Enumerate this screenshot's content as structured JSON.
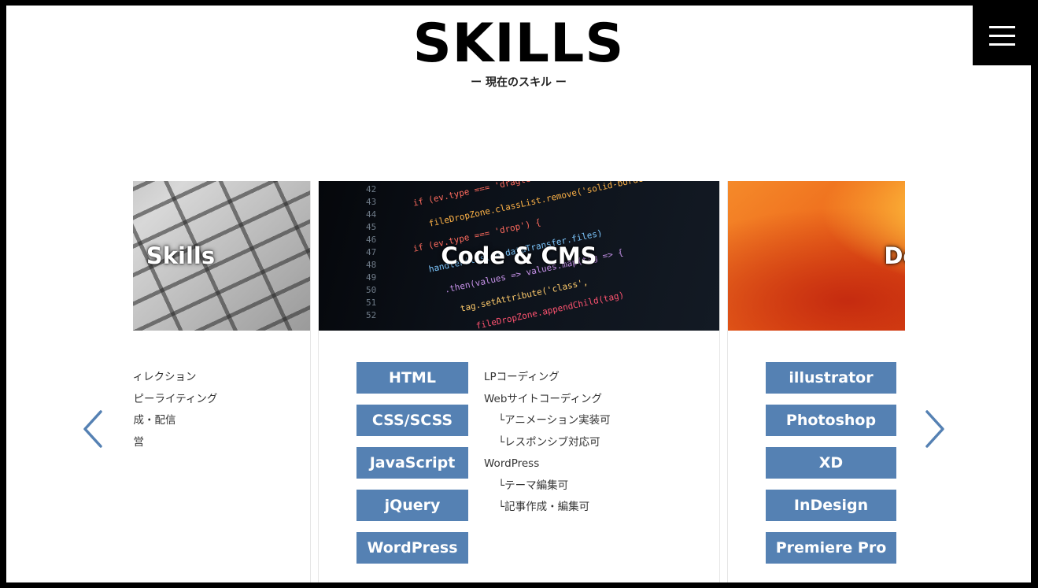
{
  "header": {
    "title": "SKILLS",
    "subtitle": "ー 現在のスキル ー"
  },
  "menu": {
    "icon": "hamburger-menu-icon"
  },
  "nav": {
    "prev_icon": "chevron-left-icon",
    "next_icon": "chevron-right-icon",
    "accent": "#5581b3"
  },
  "cards": [
    {
      "title": "Skills",
      "image": "keyboard-photo",
      "lines": [
        "ディレクション",
        "コピーライティング",
        "作成・配信",
        "運営"
      ]
    },
    {
      "title": "Code & CMS",
      "image": "code-screen-photo",
      "buttons": [
        "HTML",
        "CSS/SCSS",
        "JavaScript",
        "jQuery",
        "WordPress"
      ],
      "lines": [
        {
          "text": "LPコーディング",
          "indent": false
        },
        {
          "text": "Webサイトコーディング",
          "indent": false
        },
        {
          "text": "└アニメーション実装可",
          "indent": true
        },
        {
          "text": "└レスポンシブ対応可",
          "indent": true
        },
        {
          "text": "WordPress",
          "indent": false
        },
        {
          "text": "└テーマ編集可",
          "indent": true
        },
        {
          "text": "└記事作成・編集可",
          "indent": true
        }
      ]
    },
    {
      "title": "Design",
      "image": "abstract-orange-photo",
      "buttons": [
        "illustrator",
        "Photoshop",
        "XD",
        "InDesign",
        "Premiere Pro"
      ]
    }
  ],
  "colors": {
    "button_bg": "#5581b3",
    "frame": "#000000",
    "background": "#ffffff"
  }
}
